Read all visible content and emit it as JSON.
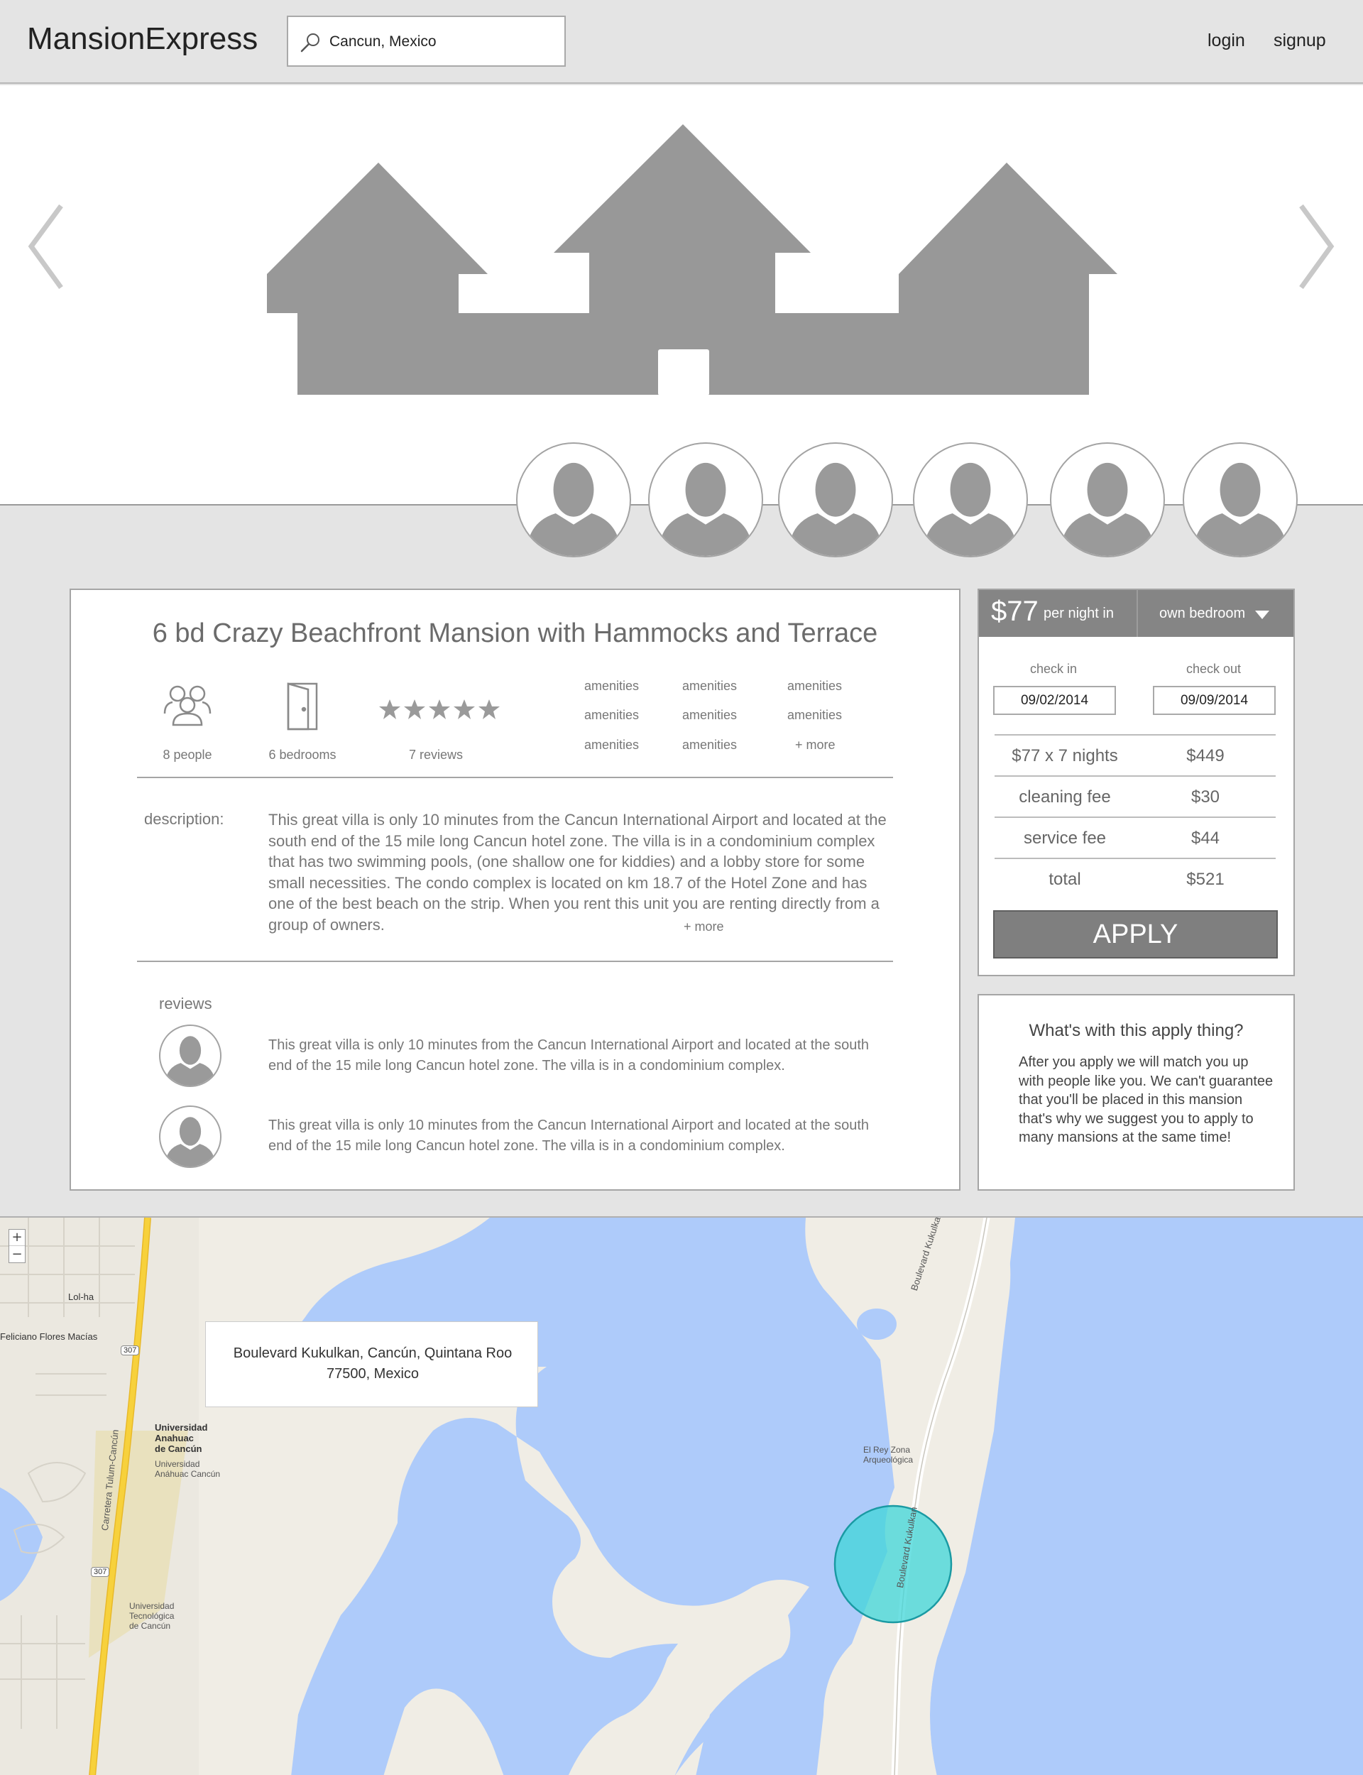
{
  "header": {
    "logo": "MansionExpress",
    "search_value": "Cancun, Mexico",
    "login": "login",
    "signup": "signup"
  },
  "hero": {
    "prev_icon": "chevron-left-icon",
    "next_icon": "chevron-right-icon",
    "image_icon": "house-placeholder-icon",
    "host_avatars": 6
  },
  "listing": {
    "title": "6 bd Crazy Beachfront Mansion with Hammocks and Terrace",
    "stats": {
      "people": "8 people",
      "bedrooms": "6 bedrooms",
      "reviews": "7 reviews",
      "rating_stars": 5
    },
    "amenities": [
      "amenities",
      "amenities",
      "amenities",
      "amenities",
      "amenities",
      "amenities",
      "amenities",
      "amenities"
    ],
    "amenities_more": "+ more",
    "description_label": "description:",
    "description": "This great villa is only 10 minutes from the Cancun International Airport and located at the south end of the 15 mile long Cancun hotel zone. The villa is in a condominium complex that has two swimming pools, (one shallow one for kiddies) and a lobby store for some small necessities. The condo complex is located on km 18.7 of the Hotel Zone and has one of the best beach on the strip. When you rent this unit you are renting directly from a group of owners.",
    "description_more": "+ more",
    "reviews_label": "reviews",
    "reviews": [
      "This great villa is only 10 minutes from the Cancun International Airport and located at the south end of the 15 mile long Cancun hotel zone. The villa is in a condominium complex.",
      "This great villa is only 10 minutes from the Cancun International Airport and located at the south end of the 15 mile long Cancun hotel zone. The villa is in a condominium complex."
    ]
  },
  "booking": {
    "price": "$77",
    "price_unit": "per night in",
    "room_type": "own bedroom",
    "check_in_label": "check in",
    "check_out_label": "check out",
    "check_in": "09/02/2014",
    "check_out": "09/09/2014",
    "fees": [
      {
        "label": "$77 x 7 nights",
        "value": "$449"
      },
      {
        "label": "cleaning fee",
        "value": "$30"
      },
      {
        "label": "service fee",
        "value": "$44"
      },
      {
        "label": "total",
        "value": "$521"
      }
    ],
    "apply": "APPLY"
  },
  "apply_info": {
    "title": "What's with this apply thing?",
    "text": "After you apply we will match you up with people like you. We can't guarantee that you'll be placed in this mansion that's why we suggest you to apply to many mansions at the same time!"
  },
  "map": {
    "address": "Boulevard Kukulkan, Cancún, Quintana Roo 77500, Mexico",
    "zoom_in": "+",
    "zoom_out": "−",
    "labels": {
      "lol_ha": "Lol-ha",
      "feliciano": "Feliciano Flores Macías",
      "universidad_anahuac": "Universidad\nAnahuac\nde Cancún",
      "universidad_anahuac_sub": "Universidad\nAnáhuac Cancún",
      "universidad_tecnologica": "Universidad\nTecnológica\nde Cancún",
      "el_rey": "El Rey Zona\nArqueológica",
      "boulevard_kukulkan": "Boulevard Kukulkan",
      "carretera": "Carretera Tulum-Cancún",
      "shield_307": "307"
    },
    "colors": {
      "water": "#aecbfa",
      "land": "#f0ede5",
      "highway": "#f7d13c",
      "marker": "#3fd6d8"
    }
  }
}
